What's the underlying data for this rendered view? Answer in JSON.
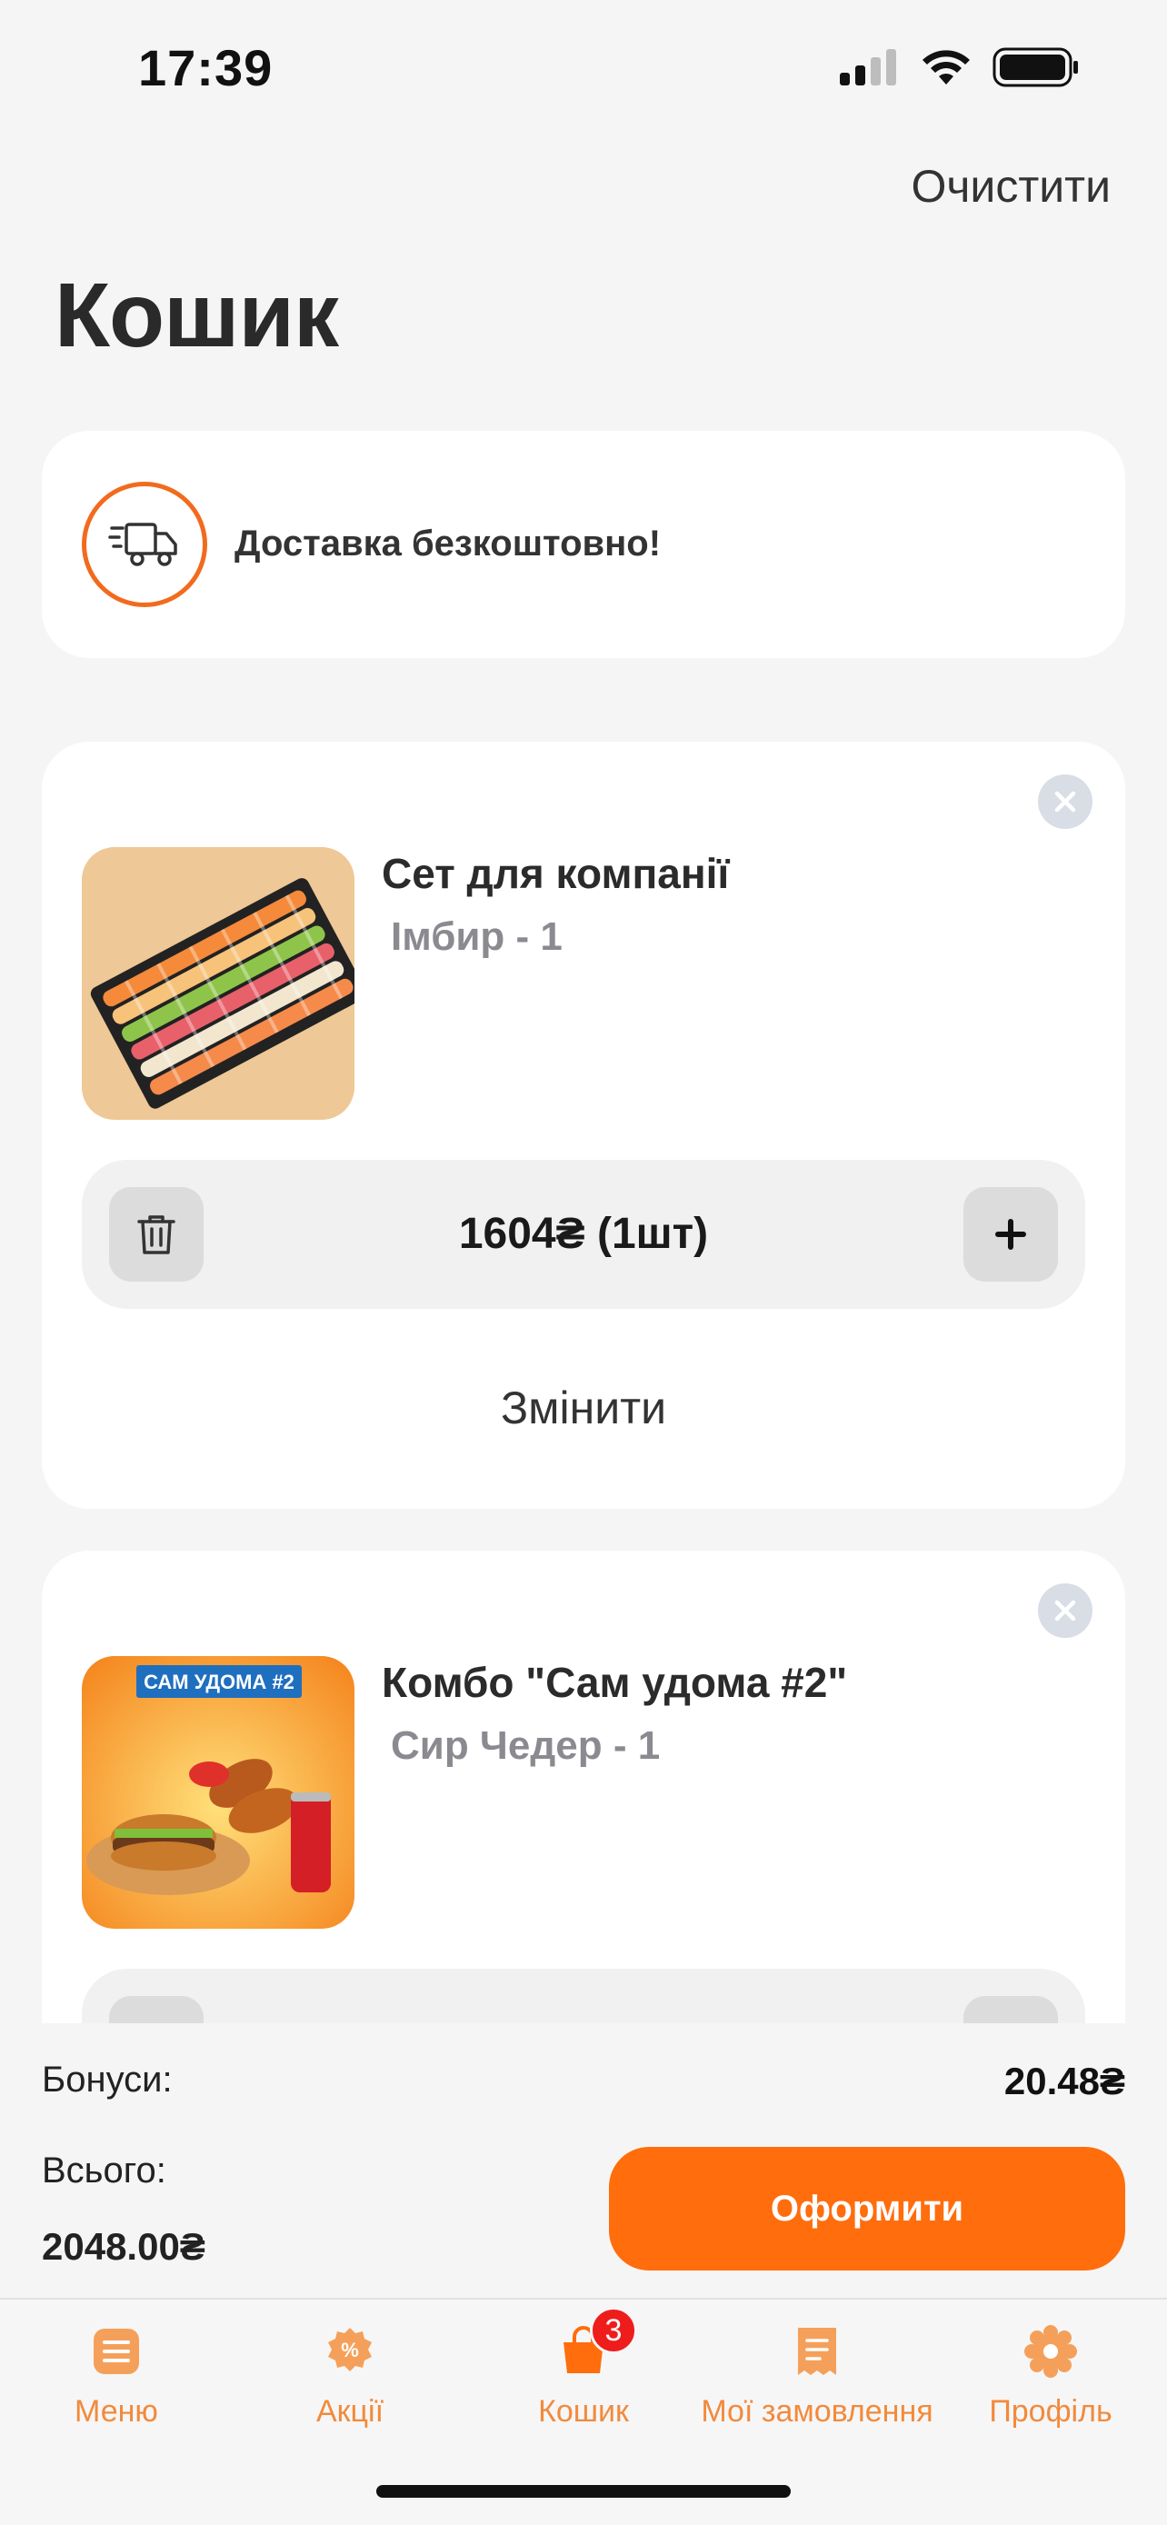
{
  "status_bar": {
    "time": "17:39"
  },
  "header": {
    "clear_label": "Очистити",
    "title": "Кошик"
  },
  "delivery": {
    "text": "Доставка безкоштовно!",
    "icon": "delivery-truck-icon"
  },
  "cart_items": [
    {
      "name": "Сет для компанії",
      "modifier": "Імбир  - 1",
      "price_qty": "1604₴  (1шт)",
      "change_label": "Змінити"
    },
    {
      "name": "Комбо \"Сам удома #2\"",
      "modifier": "Сир Чедер - 1",
      "image_caption": "САМ УДОМА #2"
    }
  ],
  "summary": {
    "bonus_label": "Бонуси:",
    "bonus_value": "20.48₴",
    "total_label": "Всього:",
    "total_value": "2048.00₴",
    "checkout_label": "Оформити"
  },
  "tabbar": {
    "items": [
      {
        "label": "Меню",
        "icon": "menu-icon"
      },
      {
        "label": "Акції",
        "icon": "discount-icon"
      },
      {
        "label": "Кошик",
        "icon": "cart-icon",
        "badge": "3"
      },
      {
        "label": "Мої замовлення",
        "icon": "orders-icon"
      },
      {
        "label": "Профіль",
        "icon": "profile-icon"
      }
    ]
  },
  "colors": {
    "accent": "#ff6d0d",
    "tab_active": "#f28a3c",
    "badge": "#ef1c1c",
    "muted_text": "#8a8a90"
  }
}
